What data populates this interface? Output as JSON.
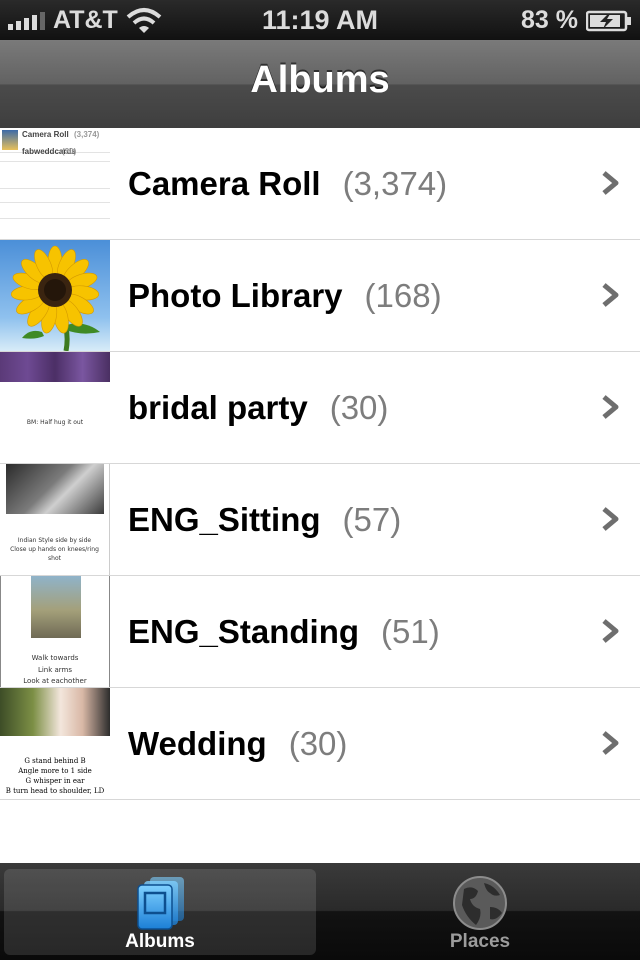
{
  "status_bar": {
    "carrier": "AT&T",
    "time": "11:19 AM",
    "battery": "83 %"
  },
  "nav": {
    "title": "Albums"
  },
  "albums": [
    {
      "name": "Camera Roll",
      "count": "(3,374)"
    },
    {
      "name": "Photo Library",
      "count": "(168)"
    },
    {
      "name": "bridal party",
      "count": "(30)"
    },
    {
      "name": "ENG_Sitting",
      "count": "(57)"
    },
    {
      "name": "ENG_Standing",
      "count": "(51)"
    },
    {
      "name": "Wedding",
      "count": "(30)"
    }
  ],
  "thumbnails": {
    "camera_roll": {
      "line1": "Camera Roll",
      "line1_count": "(3,374)",
      "line2": "fabweddcards",
      "line2_count": "(30)"
    },
    "bridal": {
      "note": "BM: Half hug it out"
    },
    "eng_sitting": {
      "note1": "Indian Style side by side",
      "note2": "Close up hands on knees/ring",
      "note3": "shot"
    },
    "eng_standing": {
      "note1": "Walk towards",
      "note2": "Link arms",
      "note3": "Look at eachother"
    },
    "wedding": {
      "note1": "G stand behind B",
      "note2": "Angle more to 1 side",
      "note3": "G whisper in ear",
      "note4": "B turn head to shoulder, LD"
    }
  },
  "tab_bar": {
    "tabs": [
      {
        "label": "Albums",
        "icon": "albums-icon",
        "selected": true
      },
      {
        "label": "Places",
        "icon": "globe-icon",
        "selected": false
      }
    ]
  },
  "colors": {
    "accent_blue": "#3aa8f0",
    "count_gray": "#7d7d7d"
  }
}
